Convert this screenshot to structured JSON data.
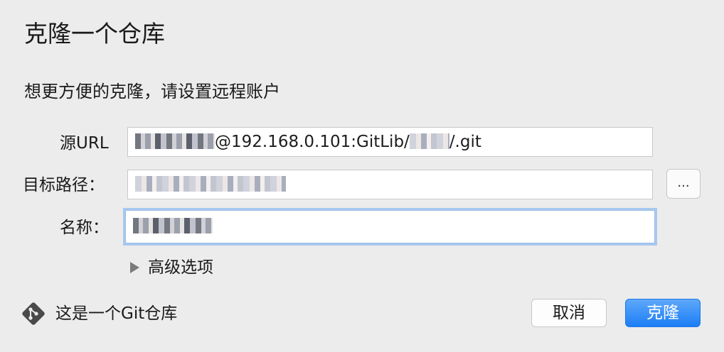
{
  "dialog": {
    "title": "克隆一个仓库",
    "subtitle": "想更方便的克隆，请设置远程账户"
  },
  "form": {
    "source_url": {
      "label": "源URL",
      "value_prefix_redacted": true,
      "value_visible": "@192.168.0.101:GitLib/",
      "value_suffix": "/.git"
    },
    "target_path": {
      "label": "目标路径：",
      "value_redacted": true
    },
    "name": {
      "label": "名称：",
      "value_redacted": true
    },
    "browse_button_label": "...",
    "advanced_options_label": "高级选项"
  },
  "footer": {
    "repo_status": "这是一个Git仓库",
    "cancel_label": "取消",
    "clone_label": "克隆"
  },
  "colors": {
    "accent": "#1c7ef5",
    "focus_ring": "#a8c8ef",
    "background": "#ececec",
    "git_icon": "#4a4a4a"
  },
  "icons": {
    "disclosure": "triangle-right-icon",
    "repo": "git-logo-icon"
  }
}
